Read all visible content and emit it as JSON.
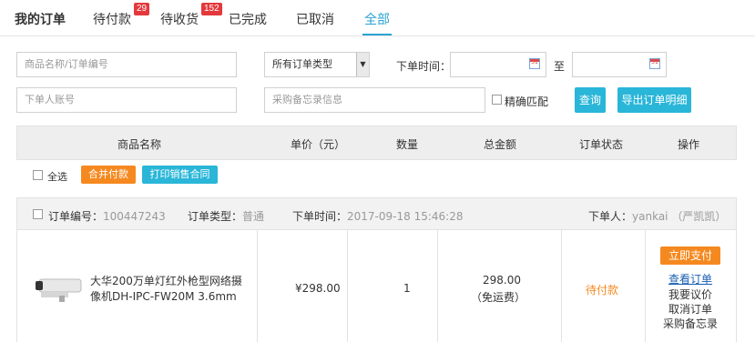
{
  "tabs": {
    "title": "我的订单",
    "pending_pay": "待付款",
    "pending_pay_count": "29",
    "pending_receive": "待收货",
    "pending_receive_count": "152",
    "completed": "已完成",
    "cancelled": "已取消",
    "all": "全部"
  },
  "filters": {
    "product_placeholder": "商品名称/订单编号",
    "order_type_value": "所有订单类型",
    "order_time_label": "下单时间：",
    "to_label": "至",
    "account_placeholder": "下单人账号",
    "memo_placeholder": "采购备忘录信息",
    "exact_match_label": "精确匹配",
    "query_button": "查询",
    "export_button": "导出订单明细"
  },
  "table_header": {
    "product_name": "商品名称",
    "unit_price": "单价（元）",
    "quantity": "数量",
    "total": "总金额",
    "status": "订单状态",
    "actions": "操作"
  },
  "batch": {
    "select_all": "全选",
    "merge_pay": "合并付款",
    "print_contract": "打印销售合同"
  },
  "order": {
    "no_label": "订单编号：",
    "no_value": "100447243",
    "type_label": "订单类型：",
    "type_value": "普通",
    "time_label": "下单时间：",
    "time_value": "2017-09-18 15:46:28",
    "buyer_label": "下单人：",
    "buyer_value": "yankai （严凯凯）",
    "product_line1": "大华200万单灯红外枪型网络摄",
    "product_line2": "像机DH-IPC-FW20M 3.6mm",
    "unit_price": "¥298.00",
    "quantity": "1",
    "total": "298.00",
    "shipping_note": "（免运费）",
    "status": "待付款",
    "pay_now": "立即支付",
    "view_order": "查看订单",
    "negotiate": "我要议价",
    "cancel_order": "取消订单",
    "purchase_memo": "采购备忘录"
  },
  "colors": {
    "accent": "#29a3d4",
    "badge": "#e4393c",
    "orange": "#f5891f",
    "button_blue": "#29b6d8"
  }
}
